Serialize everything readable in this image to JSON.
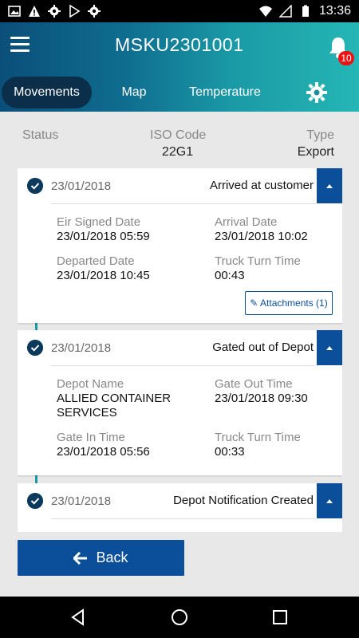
{
  "status_bar": {
    "time": "13:36",
    "left_icons": [
      "image-icon",
      "warning-icon",
      "gear-icon",
      "play-store-icon",
      "gear-icon"
    ],
    "right_icons": [
      "wifi-icon",
      "signal-icon",
      "battery-icon"
    ]
  },
  "header": {
    "title": "MSKU2301001",
    "notification_count": "10"
  },
  "tabs": {
    "movements": "Movements",
    "map": "Map",
    "temperature": "Temperature"
  },
  "info": {
    "status_label": "Status",
    "status_value": "",
    "iso_label": "ISO Code",
    "iso_value": "22G1",
    "type_label": "Type",
    "type_value": "Export"
  },
  "cards": [
    {
      "date": "23/01/2018",
      "event": "Arrived at customer",
      "fields": [
        {
          "label": "Eir Signed Date",
          "value": "23/01/2018 05:59"
        },
        {
          "label": "Arrival Date",
          "value": "23/01/2018 10:02"
        },
        {
          "label": "Departed Date",
          "value": "23/01/2018 10:45"
        },
        {
          "label": "Truck Turn Time",
          "value": "00:43"
        }
      ],
      "attachments_label": "Attachments (1)"
    },
    {
      "date": "23/01/2018",
      "event": "Gated out of Depot",
      "fields": [
        {
          "label": "Depot Name",
          "value": "ALLIED CONTAINER SERVICES"
        },
        {
          "label": "Gate Out Time",
          "value": "23/01/2018 09:30"
        },
        {
          "label": "Gate In Time",
          "value": "23/01/2018 05:56"
        },
        {
          "label": "Truck Turn Time",
          "value": "00:33"
        }
      ]
    },
    {
      "date": "23/01/2018",
      "event": "Depot Notification Created"
    }
  ],
  "back_label": "Back",
  "colors": {
    "primary": "#0b4f9a",
    "timeline": "#1b9aa8",
    "tab_active": "#0b2f4a"
  }
}
